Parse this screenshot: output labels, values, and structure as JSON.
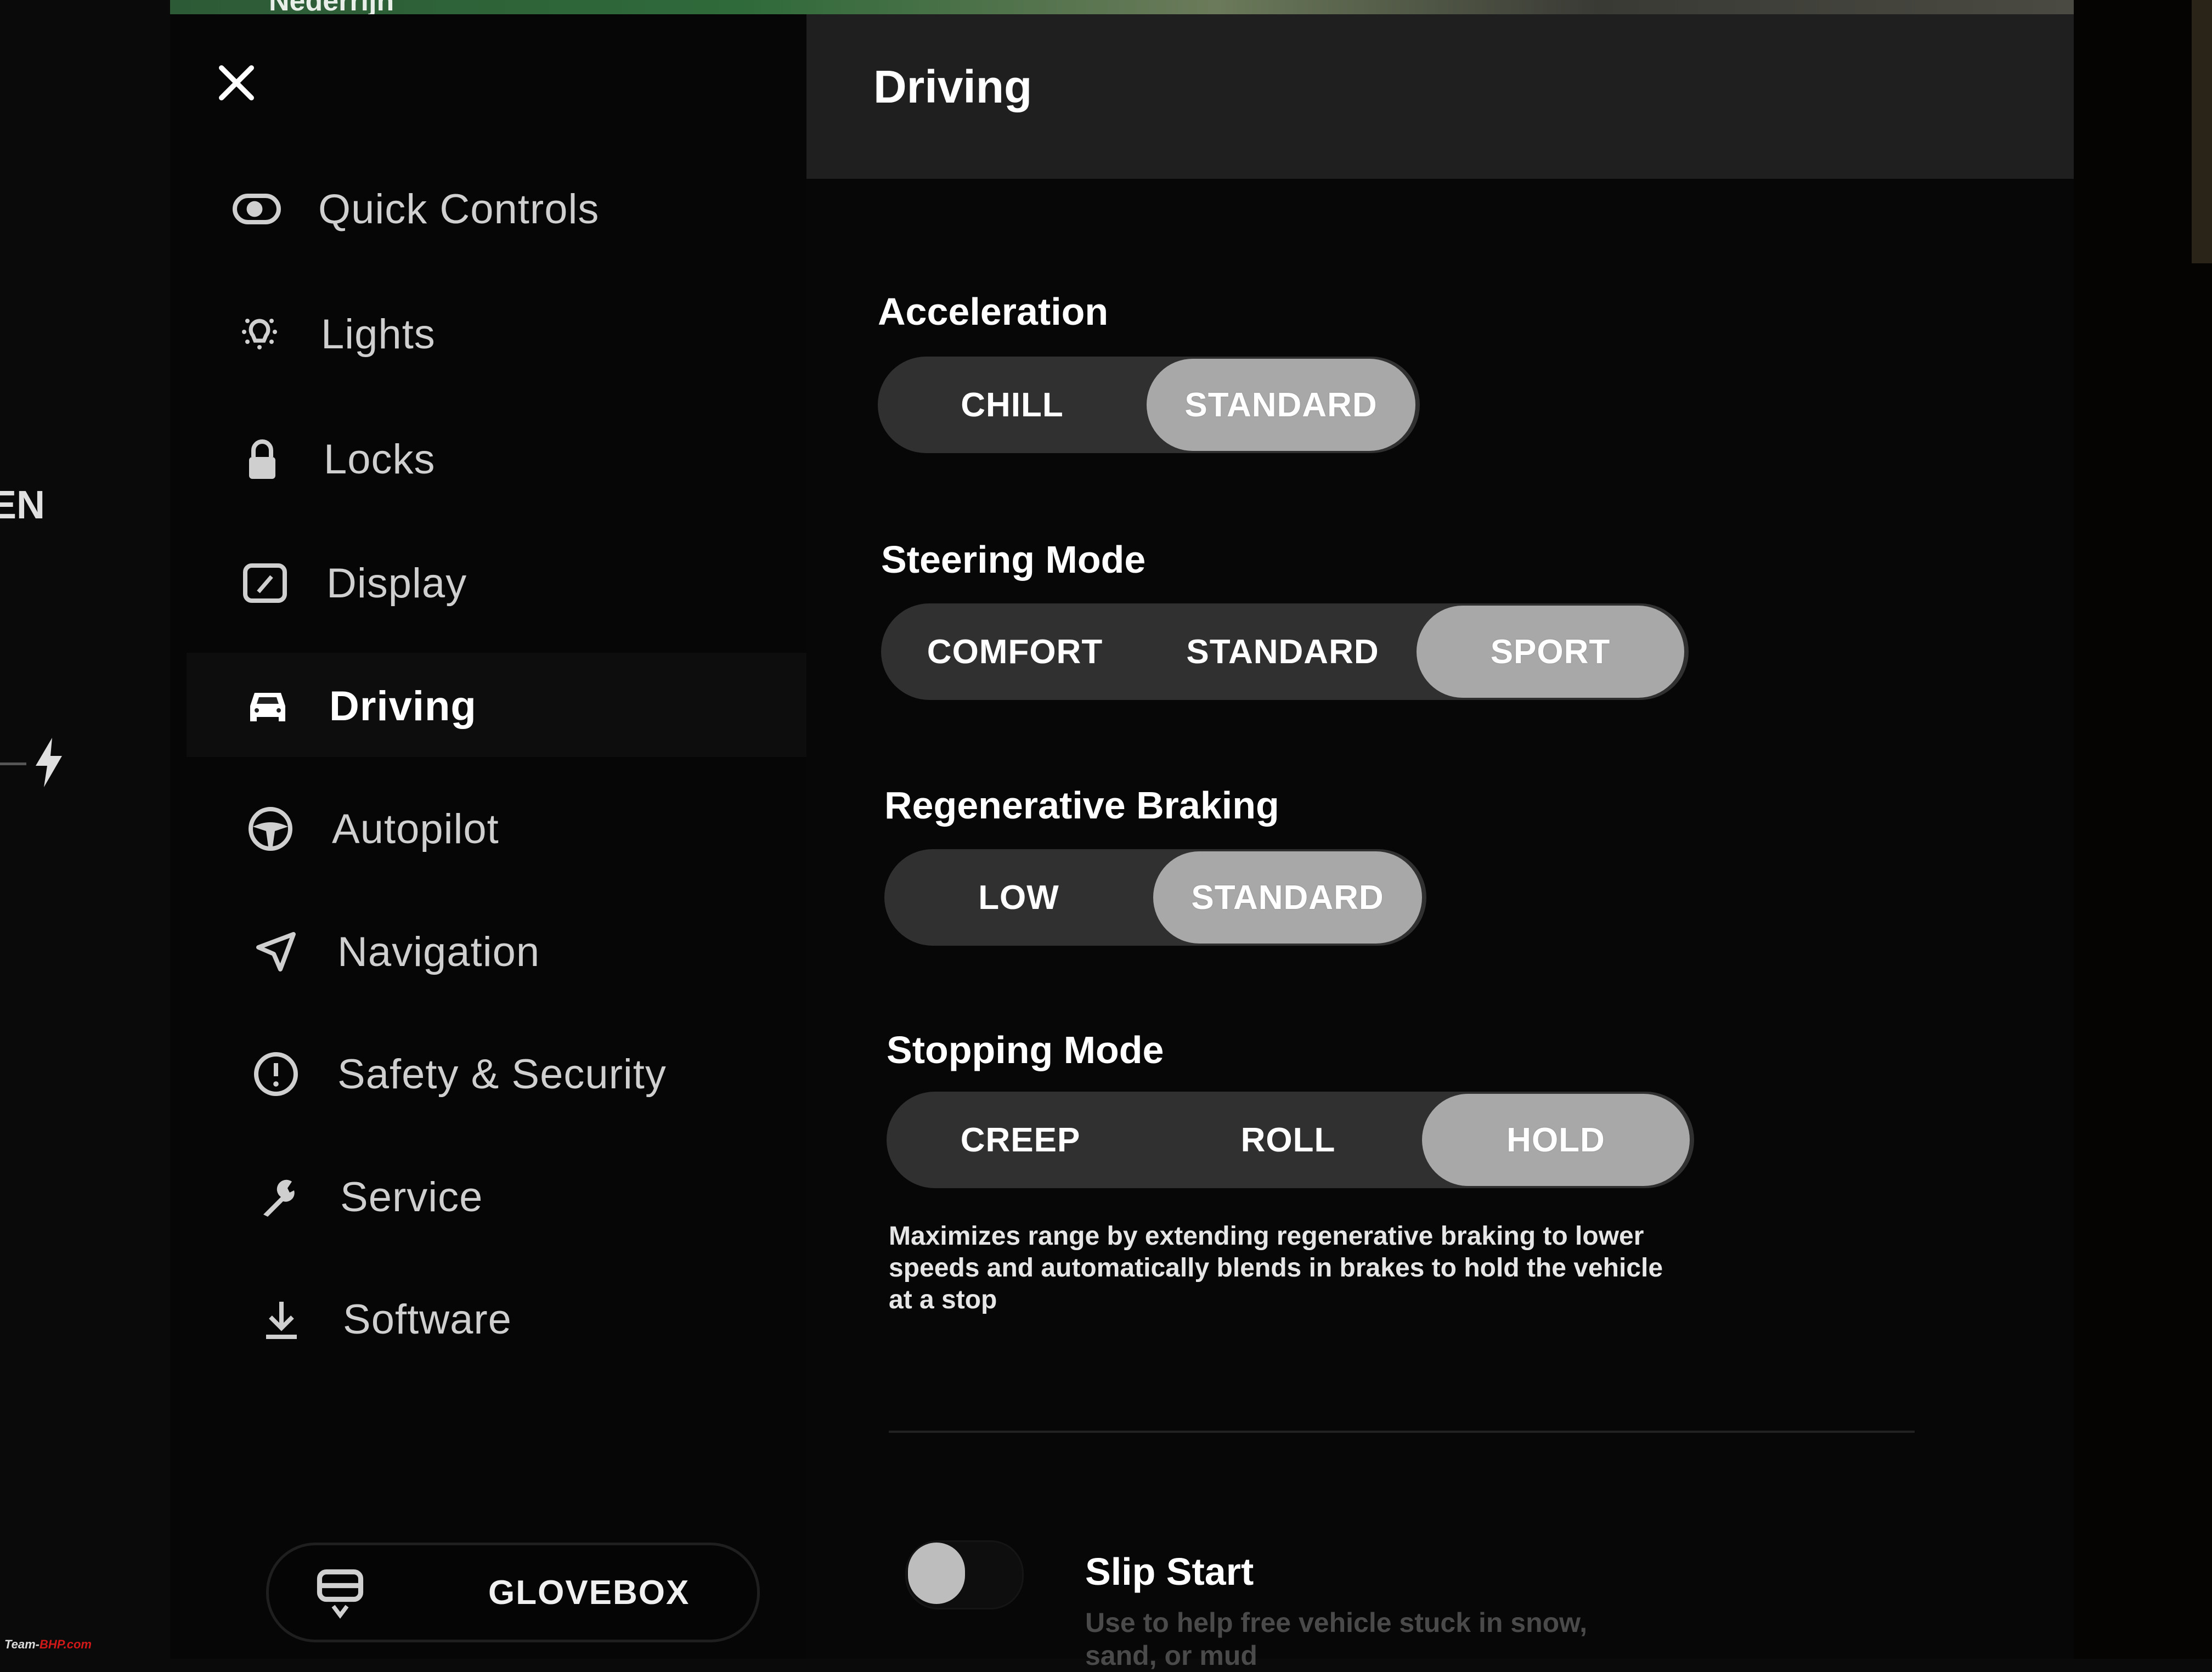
{
  "background": {
    "map_label": "Nederrijn",
    "edge_label": "EN"
  },
  "sidebar": {
    "close_icon": "close-icon",
    "items": [
      {
        "label": "Quick Controls",
        "icon": "toggle-icon",
        "active": false
      },
      {
        "label": "Lights",
        "icon": "lightbulb-icon",
        "active": false
      },
      {
        "label": "Locks",
        "icon": "lock-icon",
        "active": false
      },
      {
        "label": "Display",
        "icon": "display-icon",
        "active": false
      },
      {
        "label": "Driving",
        "icon": "car-icon",
        "active": true
      },
      {
        "label": "Autopilot",
        "icon": "steering-wheel-icon",
        "active": false
      },
      {
        "label": "Navigation",
        "icon": "navigation-arrow-icon",
        "active": false
      },
      {
        "label": "Safety & Security",
        "icon": "alert-circle-icon",
        "active": false
      },
      {
        "label": "Service",
        "icon": "wrench-icon",
        "active": false
      },
      {
        "label": "Software",
        "icon": "download-icon",
        "active": false
      }
    ],
    "glovebox_label": "GLOVEBOX"
  },
  "main": {
    "title": "Driving",
    "sections": [
      {
        "title": "Acceleration",
        "options": [
          "CHILL",
          "STANDARD"
        ],
        "selected": "STANDARD"
      },
      {
        "title": "Steering Mode",
        "options": [
          "COMFORT",
          "STANDARD",
          "SPORT"
        ],
        "selected": "SPORT"
      },
      {
        "title": "Regenerative Braking",
        "options": [
          "LOW",
          "STANDARD"
        ],
        "selected": "STANDARD"
      },
      {
        "title": "Stopping Mode",
        "options": [
          "CREEP",
          "ROLL",
          "HOLD"
        ],
        "selected": "HOLD"
      }
    ],
    "stopping_description": "Maximizes range by extending regenerative braking to lower speeds and automatically blends in brakes to hold the vehicle at a stop",
    "slip_start": {
      "title": "Slip Start",
      "description": "Use to help free vehicle stuck in snow, sand, or mud",
      "enabled": false
    }
  },
  "watermark": {
    "prefix": "Team-",
    "brand": "BHP.com"
  },
  "colors": {
    "selected_segment": "#a8a8a8",
    "segment_track": "#303030",
    "header": "#1f1f1f"
  }
}
